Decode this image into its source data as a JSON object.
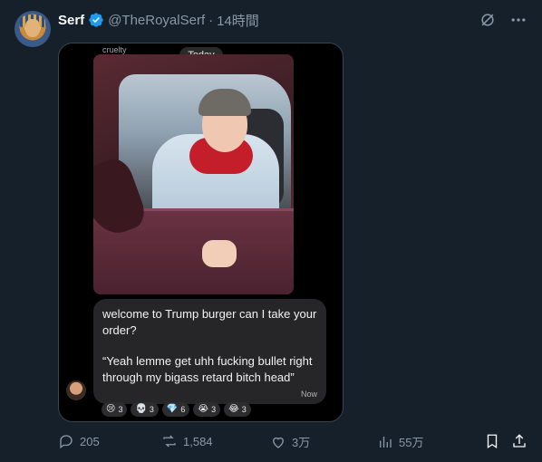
{
  "author": {
    "name": "Serf",
    "handle": "@TheRoyalSerf",
    "separator": "·",
    "time": "14時間"
  },
  "media": {
    "watermark": "cruelty",
    "date_pill": "Today",
    "message": {
      "line1": "welcome to Trump burger can I take your order?",
      "line2": "“Yeah lemme get uhh fucking bullet right through my bigass retard bitch head”",
      "timestamp": "Now"
    },
    "reactions": [
      {
        "icon": "😢",
        "count": "3"
      },
      {
        "icon": "💀",
        "count": "3"
      },
      {
        "icon": "💎",
        "count": "6"
      },
      {
        "icon": "😭",
        "count": "3"
      },
      {
        "icon": "😂",
        "count": "3"
      }
    ]
  },
  "actions": {
    "replies": "205",
    "reposts": "1,584",
    "likes": "3万",
    "views": "55万"
  },
  "colors": {
    "background": "#15202b",
    "verified": "#1d9bf0",
    "muted": "#8b98a5"
  }
}
